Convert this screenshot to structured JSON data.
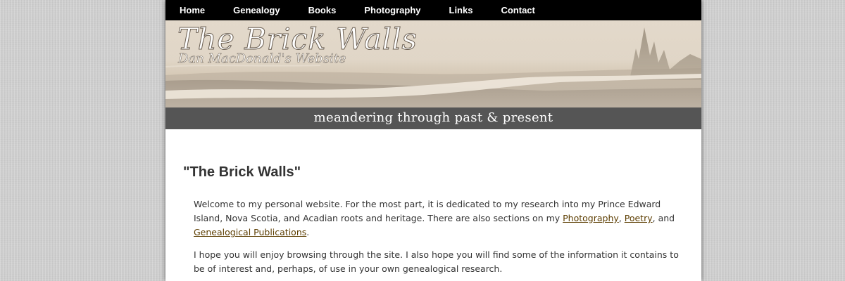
{
  "nav": {
    "items": [
      "Home",
      "Genealogy",
      "Books",
      "Photography",
      "Links",
      "Contact"
    ]
  },
  "banner": {
    "title": "The Brick Walls",
    "subtitle": "Dan MacDonald's Website"
  },
  "tagline": "meandering through past & present",
  "content": {
    "heading": "\"The Brick Walls\"",
    "paragraph1": {
      "text1": "Welcome to my personal website. For the most part, it is dedicated to my research into my Prince Edward Island, Nova Scotia, and Acadian roots and heritage. There are also sections on my ",
      "link1": "Photography",
      "sep1": ", ",
      "link2": "Poetry",
      "sep2": ", and ",
      "link3": "Genealogical Publications",
      "end": "."
    },
    "paragraph2": "I hope you will enjoy browsing through the site. I also hope you will find some of the information it contains to be of interest and, perhaps, of use in your own genealogical research."
  },
  "colors": {
    "nav_background": "#000000",
    "tagline_bar": "#555555",
    "link": "#5c3d00",
    "text": "#333333",
    "page_background": "#cfcfcf"
  }
}
